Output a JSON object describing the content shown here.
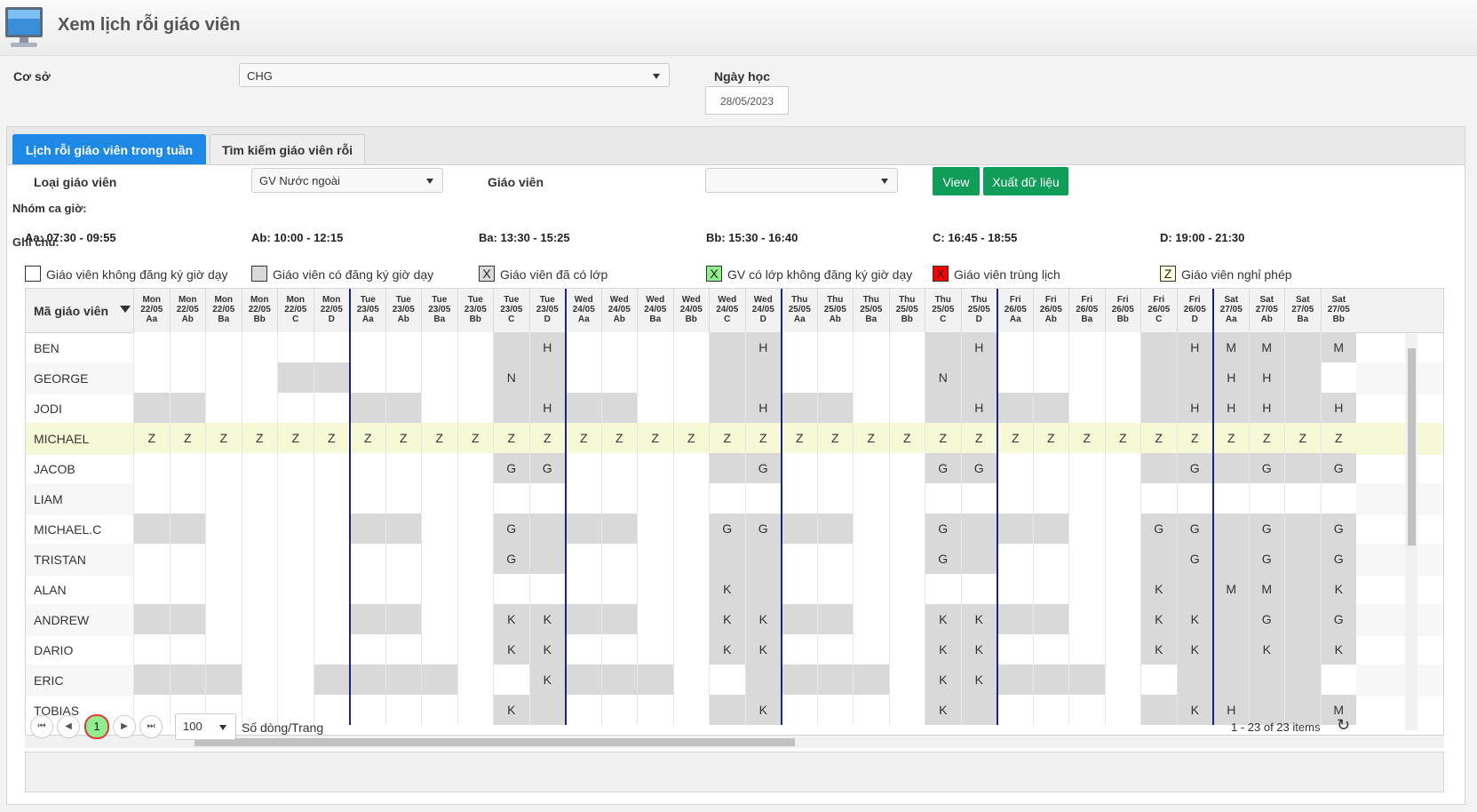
{
  "page": {
    "title": "Xem lịch rỗi giáo viên"
  },
  "filters": {
    "campus_label": "Cơ sở",
    "campus_value": "CHG",
    "date_label": "Ngày học",
    "date_value": "28/05/2023"
  },
  "tabs": [
    "Lịch rỗi giáo viên trong tuần",
    "Tìm kiếm giáo viên rỗi"
  ],
  "toolbar": {
    "teacher_type_label": "Loại giáo viên",
    "teacher_type_value": "GV Nước ngoài",
    "teacher_label": "Giáo viên",
    "teacher_value": "",
    "view_button": "View",
    "export_button": "Xuất dữ liệu"
  },
  "shift_group": {
    "label": "Nhóm ca giờ:",
    "items": [
      "Aa: 07:30 - 09:55",
      "Ab: 10:00 - 12:15",
      "Ba: 13:30 - 15:25",
      "Bb: 15:30 - 16:40",
      "C: 16:45 - 18:55",
      "D: 19:00 - 21:30"
    ]
  },
  "legend": {
    "label": "Ghi chú:",
    "items": [
      {
        "mark": "",
        "text": "Giáo viên không đăng ký giờ dạy",
        "color": "#ffffff"
      },
      {
        "mark": "",
        "text": "Giáo viên có đăng ký giờ dạy",
        "color": "#d9d9d9"
      },
      {
        "mark": "X",
        "text": "Giáo viên đã có lớp",
        "color": "#d9d9d9"
      },
      {
        "mark": "X",
        "text": "GV có lớp không đăng ký giờ dạy",
        "color": "#90ee90"
      },
      {
        "mark": "X",
        "text": "Giáo viên trùng lịch",
        "color": "#ff0000"
      },
      {
        "mark": "Z",
        "text": "Giáo viên nghỉ phép",
        "color": "#ffffe0"
      }
    ]
  },
  "grid": {
    "name_header": "Mã giáo viên",
    "days": [
      {
        "day": "Mon",
        "date": "22/05"
      },
      {
        "day": "Tue",
        "date": "23/05"
      },
      {
        "day": "Wed",
        "date": "24/05"
      },
      {
        "day": "Thu",
        "date": "25/05"
      },
      {
        "day": "Fri",
        "date": "26/05"
      },
      {
        "day": "Sat",
        "date": "27/05"
      }
    ],
    "shifts": [
      "Aa",
      "Ab",
      "Ba",
      "Bb",
      "C",
      "D"
    ],
    "rows": [
      {
        "name": "BEN",
        "reg": [
          0,
          0,
          0,
          0,
          0,
          0,
          0,
          0,
          0,
          0,
          1,
          1,
          0,
          0,
          0,
          0,
          1,
          1,
          0,
          0,
          0,
          0,
          1,
          1,
          0,
          0,
          0,
          0,
          1,
          1,
          1,
          1,
          1,
          1
        ],
        "marks": {
          "11": "H",
          "17": "H",
          "23": "H",
          "29": "H",
          "30": "M",
          "31": "M",
          "33": "M"
        }
      },
      {
        "name": "GEORGE",
        "reg": [
          0,
          0,
          0,
          0,
          1,
          1,
          0,
          0,
          0,
          0,
          1,
          1,
          0,
          0,
          0,
          0,
          1,
          1,
          0,
          0,
          0,
          0,
          1,
          1,
          0,
          0,
          0,
          0,
          1,
          1,
          1,
          1,
          1,
          0
        ],
        "marks": {
          "10": "N",
          "22": "N",
          "30": "H",
          "31": "H"
        }
      },
      {
        "name": "JODI",
        "reg": [
          1,
          1,
          0,
          0,
          0,
          0,
          1,
          1,
          0,
          0,
          1,
          1,
          1,
          1,
          0,
          0,
          1,
          1,
          1,
          1,
          0,
          0,
          1,
          1,
          1,
          1,
          0,
          0,
          1,
          1,
          1,
          1,
          1,
          1
        ],
        "marks": {
          "11": "H",
          "17": "H",
          "23": "H",
          "29": "H",
          "30": "H",
          "31": "H",
          "33": "H"
        }
      },
      {
        "name": "MICHAEL",
        "zrow": true,
        "reg": [],
        "marks": {
          "0": "Z",
          "1": "Z",
          "2": "Z",
          "3": "Z",
          "4": "Z",
          "5": "Z",
          "6": "Z",
          "7": "Z",
          "8": "Z",
          "9": "Z",
          "10": "Z",
          "11": "Z",
          "12": "Z",
          "13": "Z",
          "14": "Z",
          "15": "Z",
          "16": "Z",
          "17": "Z",
          "18": "Z",
          "19": "Z",
          "20": "Z",
          "21": "Z",
          "22": "Z",
          "23": "Z",
          "24": "Z",
          "25": "Z",
          "26": "Z",
          "27": "Z",
          "28": "Z",
          "29": "Z",
          "30": "Z",
          "31": "Z",
          "32": "Z",
          "33": "Z"
        }
      },
      {
        "name": "JACOB",
        "reg": [
          0,
          0,
          0,
          0,
          0,
          0,
          0,
          0,
          0,
          0,
          1,
          1,
          0,
          0,
          0,
          0,
          1,
          1,
          0,
          0,
          0,
          0,
          1,
          1,
          0,
          0,
          0,
          0,
          1,
          1,
          1,
          1,
          1,
          1
        ],
        "marks": {
          "10": "G",
          "11": "G",
          "17": "G",
          "22": "G",
          "23": "G",
          "29": "G",
          "31": "G",
          "33": "G"
        }
      },
      {
        "name": "LIAM",
        "reg": [
          0,
          0,
          0,
          0,
          0,
          0,
          0,
          0,
          0,
          0,
          0,
          0,
          0,
          0,
          0,
          0,
          0,
          0,
          0,
          0,
          0,
          0,
          0,
          0,
          0,
          0,
          0,
          0,
          0,
          0,
          0,
          0,
          0,
          0
        ],
        "marks": {}
      },
      {
        "name": "MICHAEL.C",
        "reg": [
          1,
          1,
          0,
          0,
          0,
          0,
          1,
          1,
          0,
          0,
          1,
          1,
          1,
          1,
          0,
          0,
          1,
          1,
          1,
          1,
          0,
          0,
          1,
          1,
          1,
          1,
          0,
          0,
          1,
          1,
          1,
          1,
          1,
          1
        ],
        "marks": {
          "10": "G",
          "16": "G",
          "17": "G",
          "22": "G",
          "28": "G",
          "29": "G",
          "31": "G",
          "33": "G"
        }
      },
      {
        "name": "TRISTAN",
        "reg": [
          0,
          0,
          0,
          0,
          0,
          0,
          0,
          0,
          0,
          0,
          1,
          1,
          0,
          0,
          0,
          0,
          1,
          1,
          0,
          0,
          0,
          0,
          1,
          1,
          0,
          0,
          0,
          0,
          1,
          1,
          1,
          1,
          1,
          1
        ],
        "marks": {
          "10": "G",
          "22": "G",
          "29": "G",
          "31": "G",
          "33": "G"
        }
      },
      {
        "name": "ALAN",
        "reg": [
          0,
          0,
          0,
          0,
          0,
          0,
          0,
          0,
          0,
          0,
          0,
          0,
          0,
          0,
          0,
          0,
          1,
          1,
          0,
          0,
          0,
          0,
          0,
          0,
          0,
          0,
          0,
          0,
          1,
          1,
          1,
          1,
          1,
          1
        ],
        "marks": {
          "16": "K",
          "28": "K",
          "30": "M",
          "31": "M",
          "33": "K"
        }
      },
      {
        "name": "ANDREW",
        "reg": [
          1,
          1,
          0,
          0,
          0,
          0,
          1,
          1,
          0,
          0,
          1,
          1,
          1,
          1,
          0,
          0,
          1,
          1,
          1,
          1,
          0,
          0,
          1,
          1,
          1,
          1,
          0,
          0,
          1,
          1,
          1,
          1,
          1,
          1
        ],
        "marks": {
          "10": "K",
          "11": "K",
          "16": "K",
          "17": "K",
          "22": "K",
          "23": "K",
          "28": "K",
          "29": "K",
          "31": "G",
          "33": "G"
        }
      },
      {
        "name": "DARIO",
        "reg": [
          0,
          0,
          0,
          0,
          0,
          0,
          0,
          0,
          0,
          0,
          1,
          1,
          0,
          0,
          0,
          0,
          1,
          1,
          0,
          0,
          0,
          0,
          1,
          1,
          0,
          0,
          0,
          0,
          1,
          1,
          1,
          1,
          1,
          1
        ],
        "marks": {
          "10": "K",
          "11": "K",
          "16": "K",
          "17": "K",
          "22": "K",
          "23": "K",
          "28": "K",
          "29": "K",
          "31": "K",
          "33": "K"
        }
      },
      {
        "name": "ERIC",
        "reg": [
          1,
          1,
          1,
          0,
          0,
          1,
          1,
          1,
          1,
          0,
          0,
          1,
          1,
          1,
          1,
          0,
          0,
          1,
          1,
          1,
          1,
          0,
          1,
          1,
          1,
          1,
          1,
          0,
          0,
          1,
          1,
          1,
          1,
          0
        ],
        "marks": {
          "11": "K",
          "22": "K",
          "23": "K"
        }
      },
      {
        "name": "TOBIAS",
        "reg": [
          0,
          0,
          0,
          0,
          0,
          0,
          0,
          0,
          0,
          0,
          1,
          1,
          0,
          0,
          0,
          0,
          1,
          1,
          0,
          0,
          0,
          0,
          1,
          1,
          0,
          0,
          0,
          0,
          1,
          1,
          1,
          1,
          1,
          1
        ],
        "marks": {
          "10": "K",
          "17": "K",
          "22": "K",
          "29": "K",
          "30": "H",
          "33": "M"
        }
      }
    ]
  },
  "pager": {
    "page": "1",
    "page_size": "100",
    "page_size_label": "Số dòng/Trang",
    "summary": "1 - 23 of 23 items"
  }
}
